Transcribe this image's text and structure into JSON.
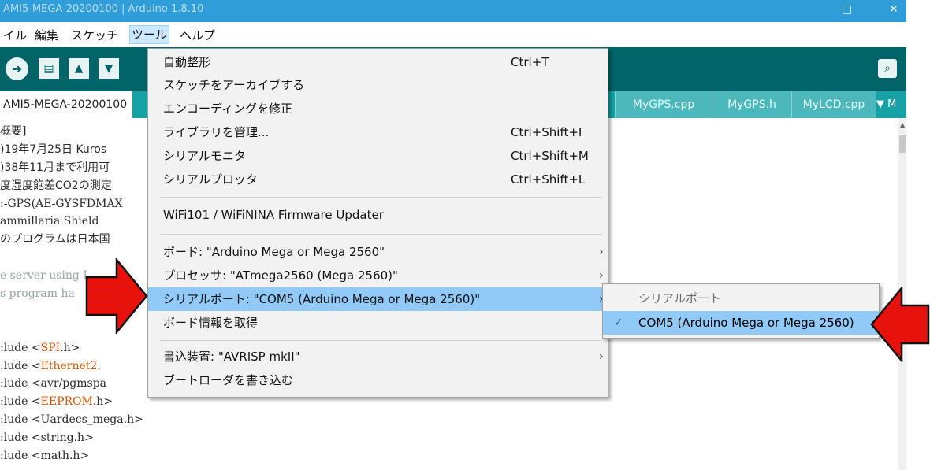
{
  "window": {
    "title": "AMI5-MEGA-20200100 | Arduino 1.8.10",
    "controls": [
      "□",
      "✕"
    ]
  },
  "menubar": {
    "items": [
      {
        "label": "イル"
      },
      {
        "label": "編集"
      },
      {
        "label": "スケッチ"
      },
      {
        "label": "ツール"
      },
      {
        "label": "ヘルプ"
      }
    ]
  },
  "toolbar": {
    "buttons": [
      "verify-upload",
      "new-sketch",
      "open-sketch",
      "save-sketch"
    ],
    "serial_monitor_icon": "magnifier-icon"
  },
  "tabs": {
    "active": "AMI5-MEGA-20200100",
    "others": [
      "MyGPS.cpp",
      "MyGPS.h",
      "MyLCD.cpp"
    ],
    "dropdown": "▼ M"
  },
  "editor": {
    "lines": [
      {
        "text": "概要]",
        "cls": "jp"
      },
      {
        "text": ")19年7月25日 Kuros",
        "cls": "jp"
      },
      {
        "text": ")38年11月まで利用可",
        "cls": "jp"
      },
      {
        "text": "度湿度飽差CO2の測定",
        "cls": "jp"
      },
      {
        "text": ":-GPS(AE-GYSFDMAX",
        "cls": ""
      },
      {
        "text": "ammillaria Shield",
        "cls": ""
      },
      {
        "text": "のプログラムは日本国",
        "cls": "jp"
      },
      {
        "text": "",
        "cls": ""
      },
      {
        "text": "e server using I",
        "cls": "cm"
      },
      {
        "text": "s program ha",
        "cls": "cm"
      },
      {
        "text": "",
        "cls": ""
      },
      {
        "text": "",
        "cls": ""
      },
      {
        "text": ":lude <SPI.h>",
        "lib": "SPI"
      },
      {
        "text": ":lude <Ethernet2.",
        "lib": "Ethernet2"
      },
      {
        "text": ":lude <avr/pgmspa",
        "cls": ""
      },
      {
        "text": ":lude <EEPROM.h>",
        "lib": "EEPROM"
      },
      {
        "text": ":lude <Uardecs_mega.h>",
        "cls": ""
      },
      {
        "text": ":lude <string.h>",
        "cls": ""
      },
      {
        "text": ":lude <math.h>",
        "cls": ""
      }
    ]
  },
  "tools_menu": {
    "items": [
      {
        "label": "自動整形",
        "shortcut": "Ctrl+T"
      },
      {
        "label": "スケッチをアーカイブする",
        "shortcut": ""
      },
      {
        "label": "エンコーディングを修正",
        "shortcut": ""
      },
      {
        "label": "ライブラリを管理...",
        "shortcut": "Ctrl+Shift+I"
      },
      {
        "label": "シリアルモニタ",
        "shortcut": "Ctrl+Shift+M"
      },
      {
        "label": "シリアルプロッタ",
        "shortcut": "Ctrl+Shift+L"
      },
      {
        "label": "WiFi101 / WiFiNINA Firmware Updater",
        "shortcut": ""
      },
      {
        "label": "ボード: \"Arduino Mega or Mega 2560\"",
        "shortcut": "",
        "submenu": true
      },
      {
        "label": "プロセッサ: \"ATmega2560 (Mega 2560)\"",
        "shortcut": "",
        "submenu": true
      },
      {
        "label": "シリアルポート: \"COM5 (Arduino Mega or Mega 2560)\"",
        "shortcut": "",
        "submenu": true,
        "highlighted": true
      },
      {
        "label": "ボード情報を取得",
        "shortcut": ""
      },
      {
        "label": "書込装置: \"AVRISP mkII\"",
        "shortcut": "",
        "submenu": true
      },
      {
        "label": "ブートローダを書き込む",
        "shortcut": ""
      }
    ],
    "submenu_arrow": "›"
  },
  "port_submenu": {
    "header": "シリアルポート",
    "items": [
      {
        "label": "COM5 (Arduino Mega or Mega 2560)",
        "checked": true,
        "check": "✓"
      }
    ]
  },
  "colors": {
    "toolbar": "#006468",
    "tabs": "#17a1a5",
    "highlight": "#91c9f7",
    "arrow": "#e8120c"
  }
}
